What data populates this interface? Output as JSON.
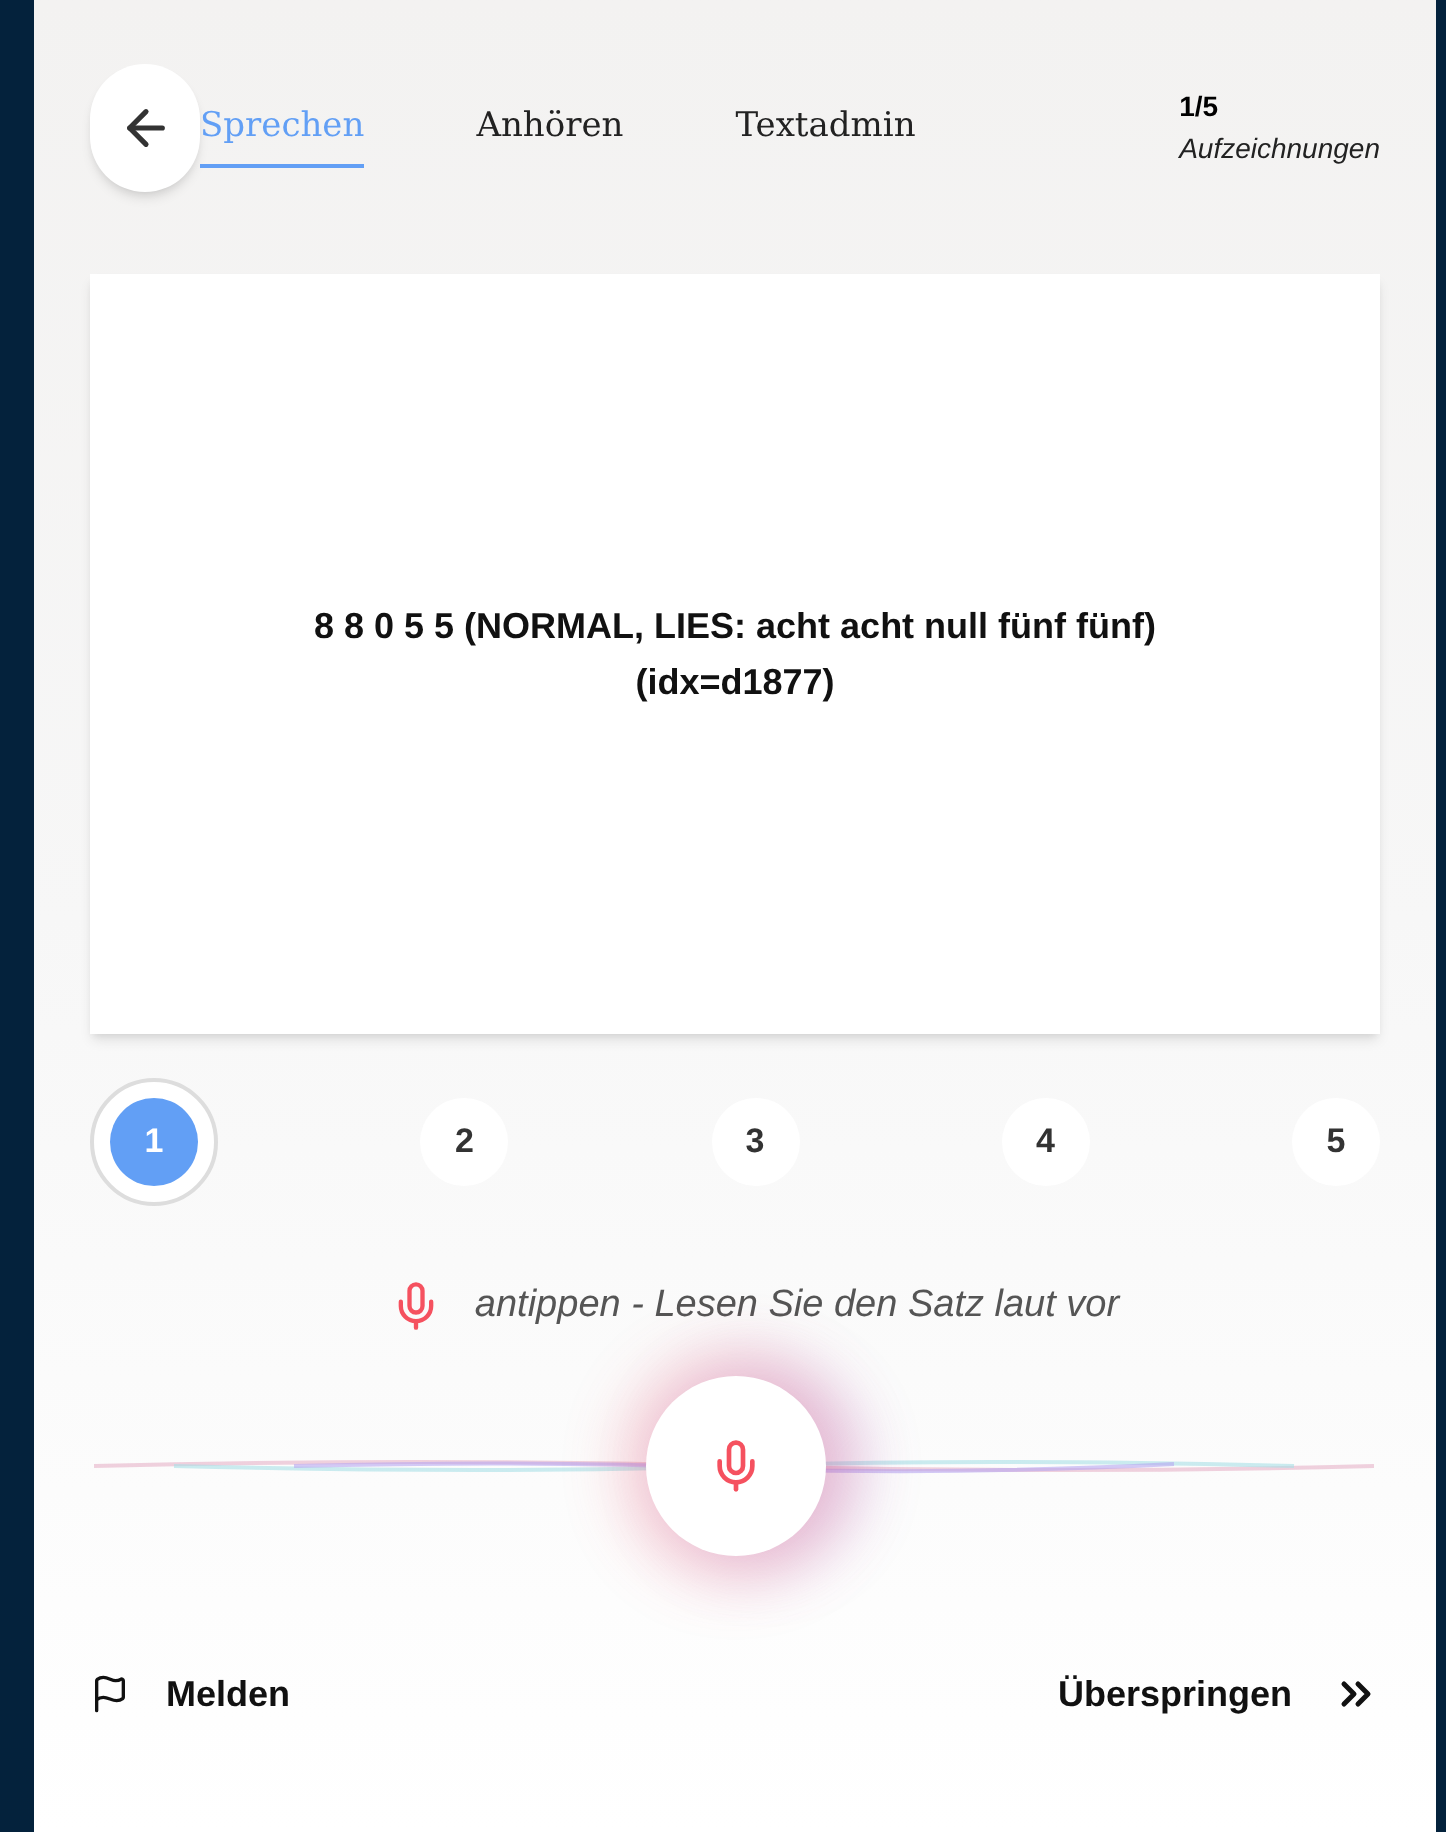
{
  "tabs": [
    {
      "label": "Sprechen",
      "selected": true
    },
    {
      "label": "Anhören",
      "selected": false
    },
    {
      "label": "Textadmin",
      "selected": false
    }
  ],
  "progress": {
    "count": "1/5",
    "label": "Aufzeichnungen"
  },
  "sentence": {
    "lines": [
      "8 8 0 5 5 (NORMAL, LIES: acht acht null fünf fünf)",
      "(idx=d1877)"
    ]
  },
  "steps": [
    {
      "label": "1",
      "selected": true
    },
    {
      "label": "2",
      "selected": false
    },
    {
      "label": "3",
      "selected": false
    },
    {
      "label": "4",
      "selected": false
    },
    {
      "label": "5",
      "selected": false
    }
  ],
  "hint": "antippen - Lesen Sie den Satz laut vor",
  "footer": {
    "report": "Melden",
    "skip": "Überspringen"
  }
}
